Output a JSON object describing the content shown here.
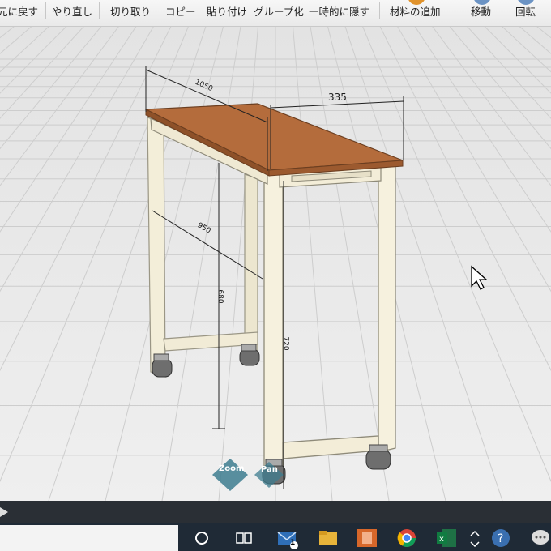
{
  "toolbar": {
    "items": [
      "元に戻す",
      "やり直し",
      "切り取り",
      "コピー",
      "貼り付け",
      "グループ化",
      "一時的に隠す",
      "材料の追加",
      "移動",
      "回転"
    ]
  },
  "model": {
    "dim_width": "1050",
    "dim_depth": "335",
    "dim_inner": "950",
    "dim_height_back": "680",
    "dim_height_front": "720"
  },
  "view_controls": {
    "zoom_label": "Zoom",
    "pan_label": "Pan"
  },
  "taskbar": {
    "mail_badge": "1"
  },
  "colors": {
    "desk_top": "#b36a3a",
    "frame": "#f2ecd8",
    "grid_bg": "#ececec",
    "grid_line": "#cfcfcf"
  }
}
